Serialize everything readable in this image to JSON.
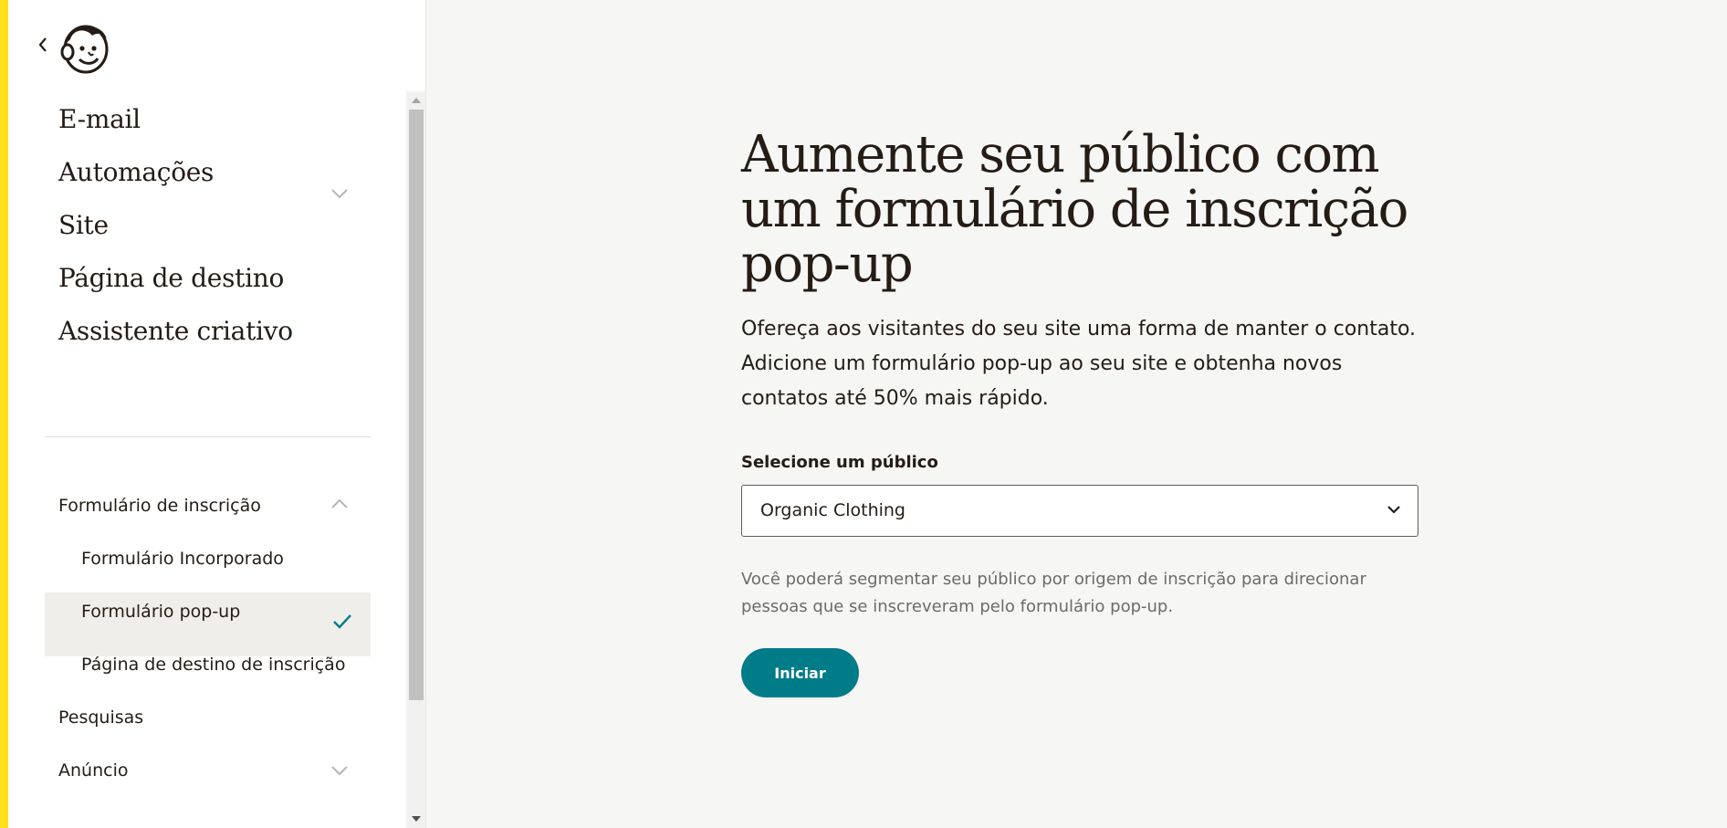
{
  "sidebar": {
    "back_icon": "chevron-left-icon",
    "logo_icon": "mailchimp-freddie-logo",
    "main_items": [
      {
        "label": "E-mail",
        "icon": "chevron-down-icon"
      },
      {
        "label": "Automações"
      },
      {
        "label": "Site"
      },
      {
        "label": "Página de destino"
      },
      {
        "label": "Assistente criativo"
      }
    ],
    "forms_section": {
      "label": "Formulário de inscrição",
      "icon": "chevron-up-icon",
      "items": [
        {
          "label": "Formulário Incorporado"
        },
        {
          "label": "Formulário pop-up",
          "selected": true,
          "icon": "checkmark-icon"
        },
        {
          "label": "Página de destino de inscrição"
        }
      ]
    },
    "other_items": [
      {
        "label": "Pesquisas"
      },
      {
        "label": "Anúncio",
        "icon": "chevron-down-icon"
      }
    ]
  },
  "main": {
    "headline": "Aumente seu público com um formulário de inscrição pop-up",
    "lead": "Ofereça aos visitantes do seu site uma forma de manter o contato. Adicione um formulário pop-up ao seu site e obtenha novos contatos até 50% mais rápido.",
    "audience_label": "Selecione um público",
    "audience_value": "Organic Clothing",
    "helper": "Você poderá segmentar seu público por origem de inscrição para direcionar pessoas que se inscreveram pelo formulário pop-up.",
    "start_label": "Iniciar"
  },
  "colors": {
    "brand_yellow": "#ffe01b",
    "primary_teal": "#007c89",
    "text_dark": "#241c15",
    "background": "#f6f6f4"
  }
}
